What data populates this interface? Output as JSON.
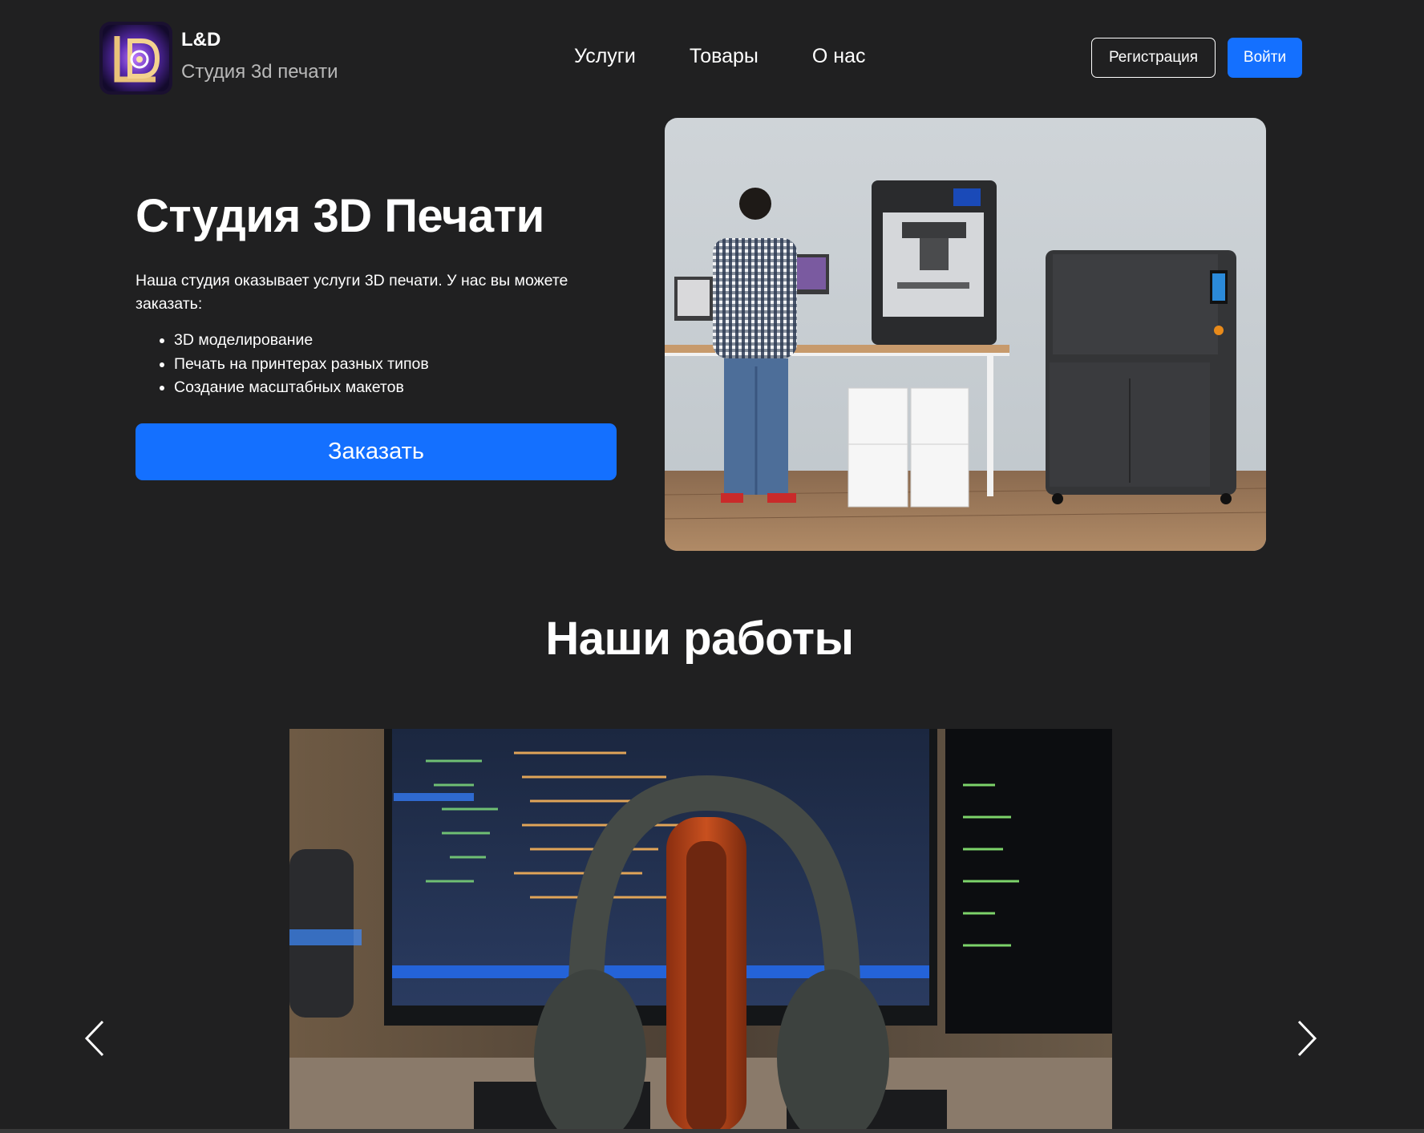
{
  "header": {
    "brand_name": "L&D",
    "brand_subtitle": "Студия 3d печати",
    "logo_icon": "ld-logo-icon",
    "nav": [
      {
        "label": "Услуги"
      },
      {
        "label": "Товары"
      },
      {
        "label": "О нас"
      }
    ],
    "register_label": "Регистрация",
    "login_label": "Войти"
  },
  "hero": {
    "title": "Студия 3D Печати",
    "description": "Наша студия оказывает услуги 3D печати. У нас вы можете заказать:",
    "services": [
      "3D моделирование",
      "Печать на принтерах разных типов",
      "Создание масштабных макетов"
    ],
    "order_label": "Заказать",
    "photo": "studio-3d-printers-photo"
  },
  "works": {
    "title": "Наши работы",
    "slide_photo": "printed-headphone-stand-photo",
    "prev_icon": "chevron-left-icon",
    "next_icon": "chevron-right-icon"
  },
  "colors": {
    "background": "#202021",
    "accent": "#1470ff",
    "text": "#ffffff",
    "muted_text": "#b9b9b9"
  }
}
